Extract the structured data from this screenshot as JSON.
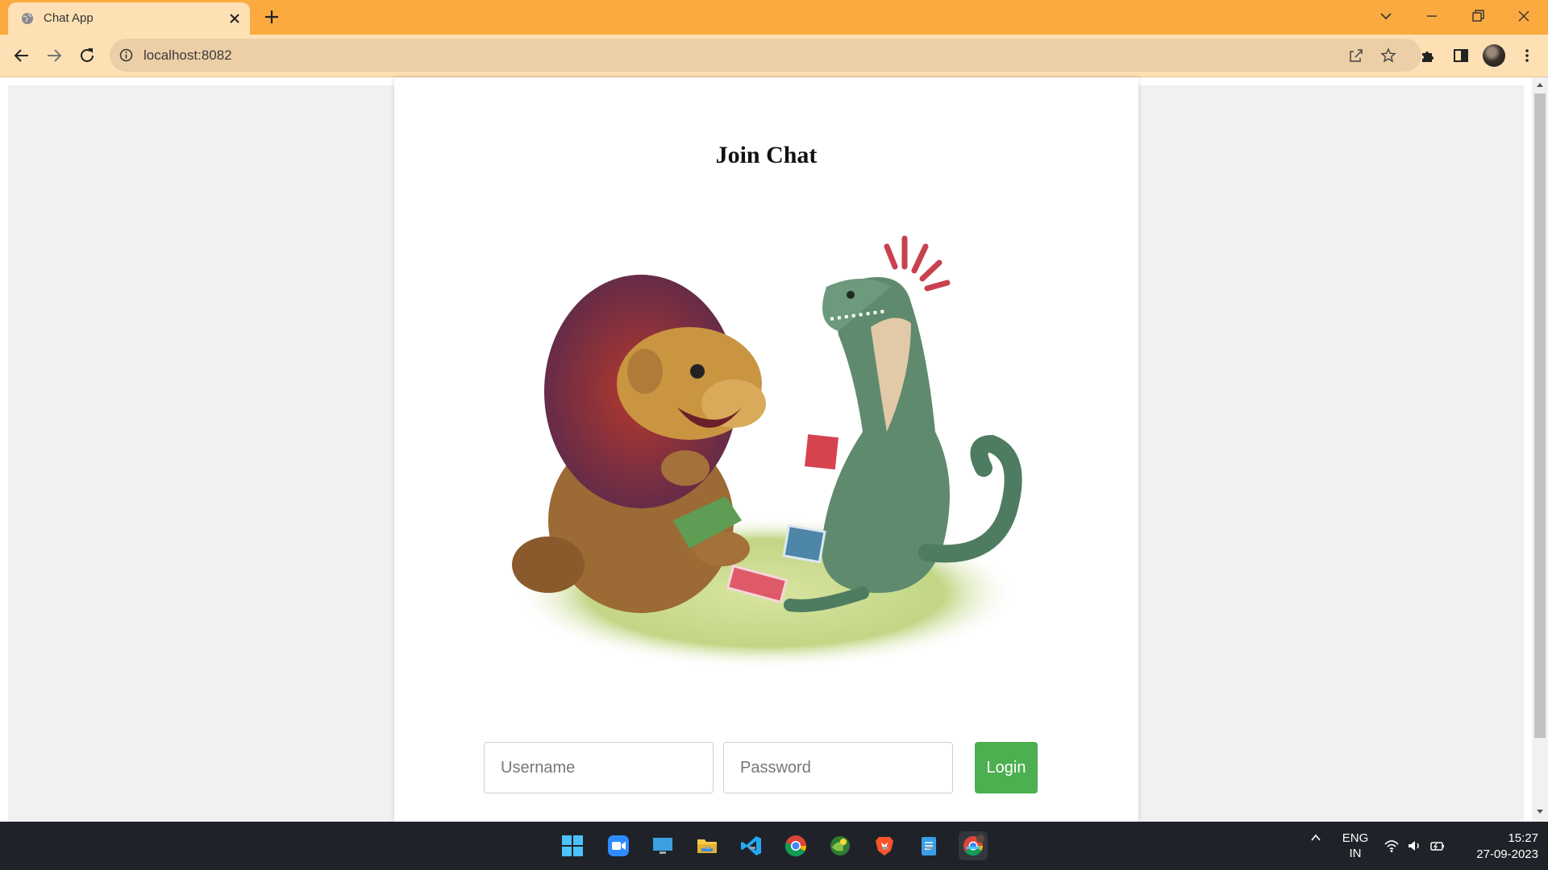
{
  "browser": {
    "tab_title": "Chat App",
    "url": "localhost:8082"
  },
  "page": {
    "title": "Join Chat",
    "hero_image_alt": "Cartoon lion and dinosaur playing cards",
    "username_placeholder": "Username",
    "password_placeholder": "Password",
    "login_label": "Login"
  },
  "taskbar": {
    "apps": [
      "start-icon",
      "zoom-icon",
      "remote-desktop-icon",
      "file-explorer-icon",
      "vscode-icon",
      "chrome-icon",
      "edge-canary-icon",
      "brave-icon",
      "notepad-icon",
      "chrome-profile-icon"
    ],
    "language_line1": "ENG",
    "language_line2": "IN",
    "time": "15:27",
    "date": "27-09-2023"
  },
  "colors": {
    "tab_strip": "#fbaa3f",
    "toolbar": "#fde0b4",
    "login_button": "#4caf50",
    "taskbar": "#1f2329"
  }
}
